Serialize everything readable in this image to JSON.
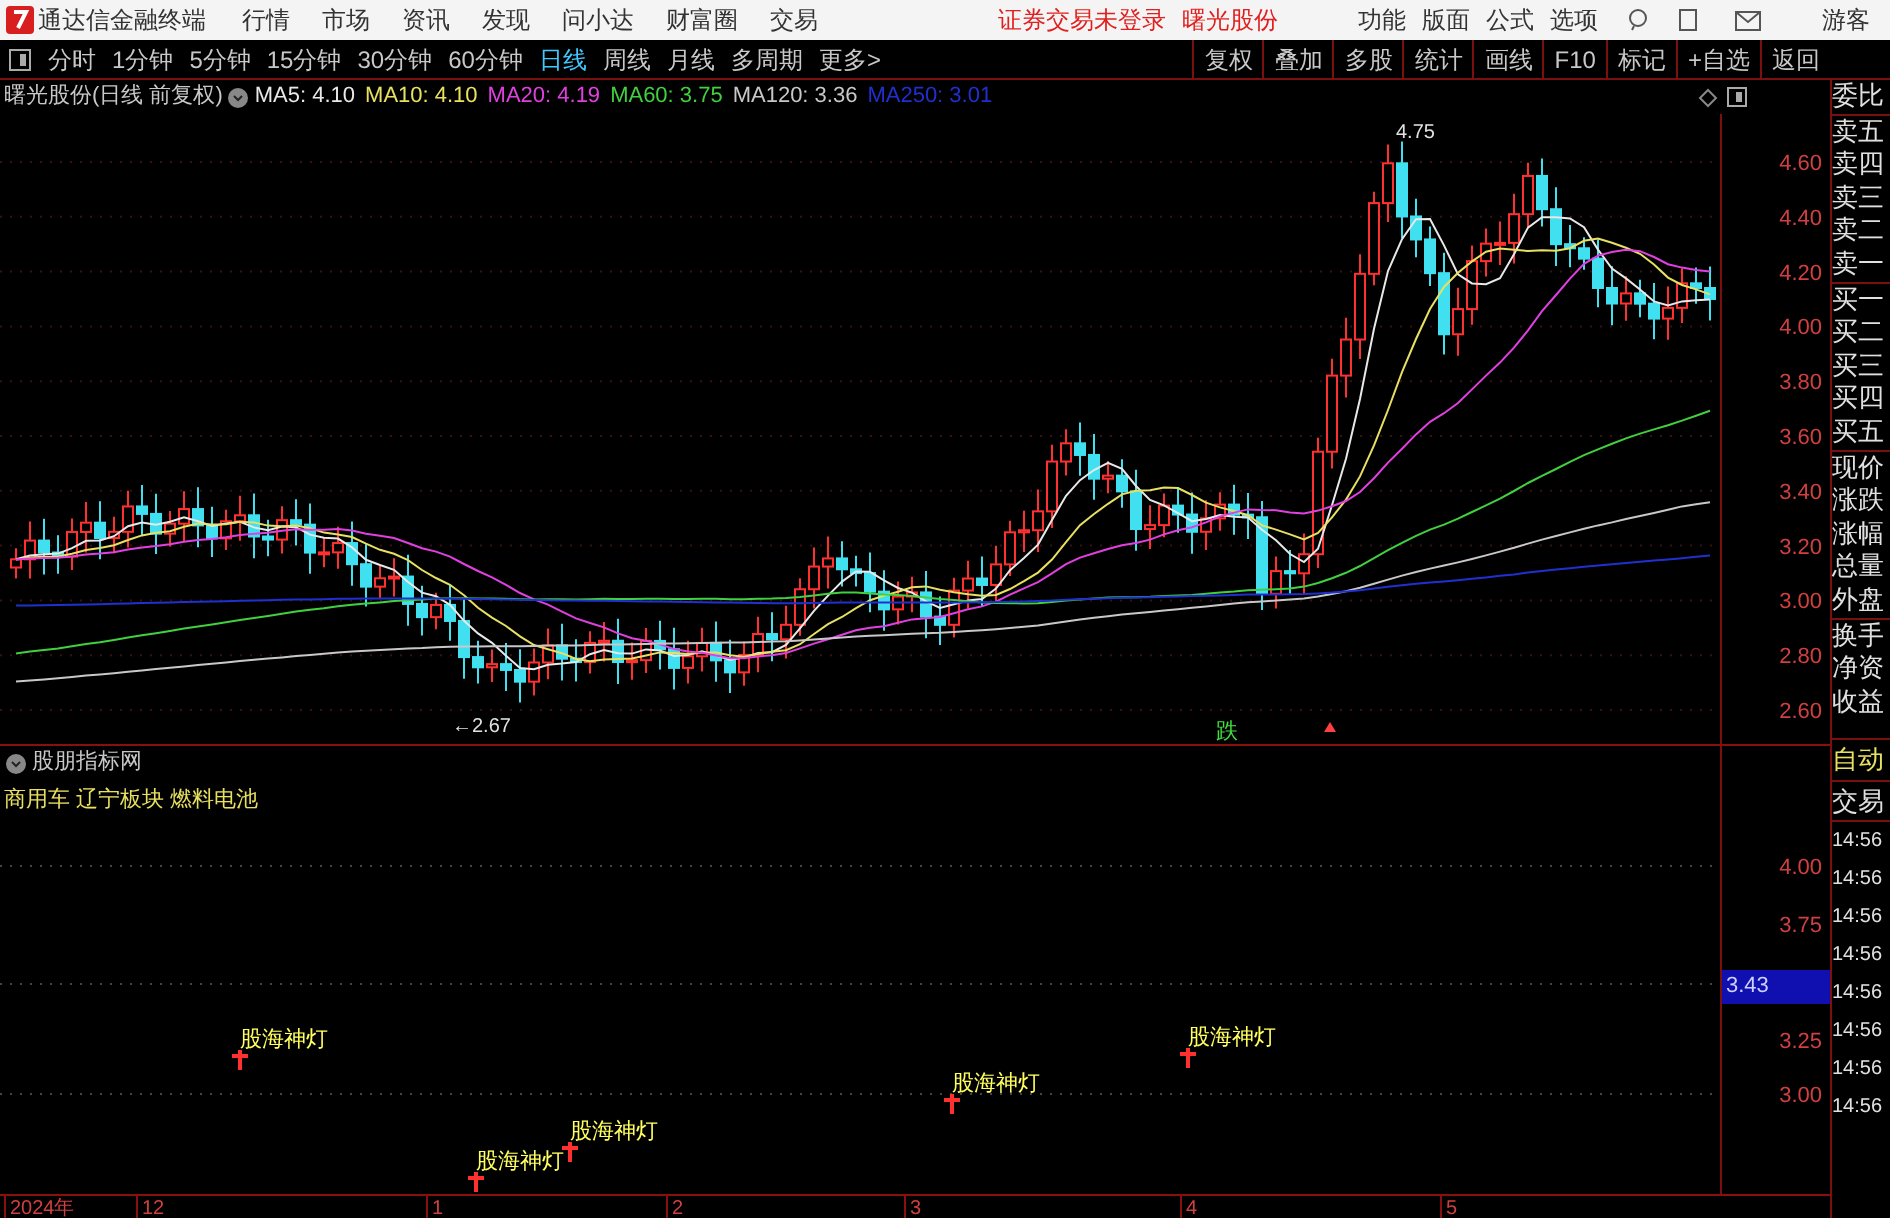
{
  "app_title": "通达信金融终端",
  "menu": [
    "行情",
    "市场",
    "资讯",
    "发现",
    "问小达",
    "财富圈",
    "交易"
  ],
  "login_status": "证券交易未登录",
  "stock_link": "曙光股份",
  "right_menu": [
    "功能",
    "版面",
    "公式",
    "选项"
  ],
  "user": "游客",
  "periods": [
    {
      "label": "分时",
      "selected": false
    },
    {
      "label": "1分钟",
      "selected": false
    },
    {
      "label": "5分钟",
      "selected": false
    },
    {
      "label": "15分钟",
      "selected": false
    },
    {
      "label": "30分钟",
      "selected": false
    },
    {
      "label": "60分钟",
      "selected": false
    },
    {
      "label": "日线",
      "selected": true
    },
    {
      "label": "周线",
      "selected": false
    },
    {
      "label": "月线",
      "selected": false
    },
    {
      "label": "多周期",
      "selected": false
    },
    {
      "label": "更多>",
      "selected": false
    }
  ],
  "tool_buttons": [
    "复权",
    "叠加",
    "多股",
    "统计",
    "画线",
    "F10",
    "标记",
    "+自选",
    "返回"
  ],
  "chart_title": "曙光股份(日线 前复权)",
  "moving_averages": [
    {
      "label": "MA5: 4.10",
      "color": "#e8e8e8"
    },
    {
      "label": "MA10: 4.10",
      "color": "#e8e060"
    },
    {
      "label": "MA20: 4.19",
      "color": "#e040e0"
    },
    {
      "label": "MA60: 3.75",
      "color": "#40d040"
    },
    {
      "label": "MA120: 3.36",
      "color": "#c8c8c8"
    },
    {
      "label": "MA250: 3.01",
      "color": "#2030d0"
    }
  ],
  "price_axis": [
    "4.60",
    "4.40",
    "4.20",
    "4.00",
    "3.80",
    "3.60",
    "3.40",
    "3.20",
    "3.00",
    "2.80",
    "2.60"
  ],
  "high_label": "4.75",
  "low_label": "←2.67",
  "signal": "跌",
  "quote_labels": [
    "委比",
    "卖五",
    "卖四",
    "卖三",
    "卖二",
    "卖一",
    "买一",
    "买二",
    "买三",
    "买四",
    "买五",
    "现价",
    "涨跌",
    "涨幅",
    "总量",
    "外盘",
    "换手",
    "净资",
    "收益"
  ],
  "auto_button": "自动",
  "trades_title": "交易",
  "trade_times": [
    "14:56",
    "14:56",
    "14:56",
    "14:56",
    "14:56",
    "14:56",
    "14:56",
    "14:56"
  ],
  "indicator": {
    "title": "股朋指标网",
    "sectors": "商用车 辽宁板块 燃料电池",
    "axis": [
      {
        "label": "4.00",
        "kind": "tick"
      },
      {
        "label": "3.75",
        "kind": "tick"
      },
      {
        "label": "3.43",
        "kind": "current"
      },
      {
        "label": "3.25",
        "kind": "tick"
      },
      {
        "label": "3.00",
        "kind": "tick"
      }
    ],
    "signals": [
      "股海神灯",
      "股海神灯",
      "股海神灯",
      "股海神灯",
      "股海神灯"
    ]
  },
  "date_axis": [
    "2024年",
    "12",
    "1",
    "2",
    "3",
    "4",
    "5"
  ]
}
